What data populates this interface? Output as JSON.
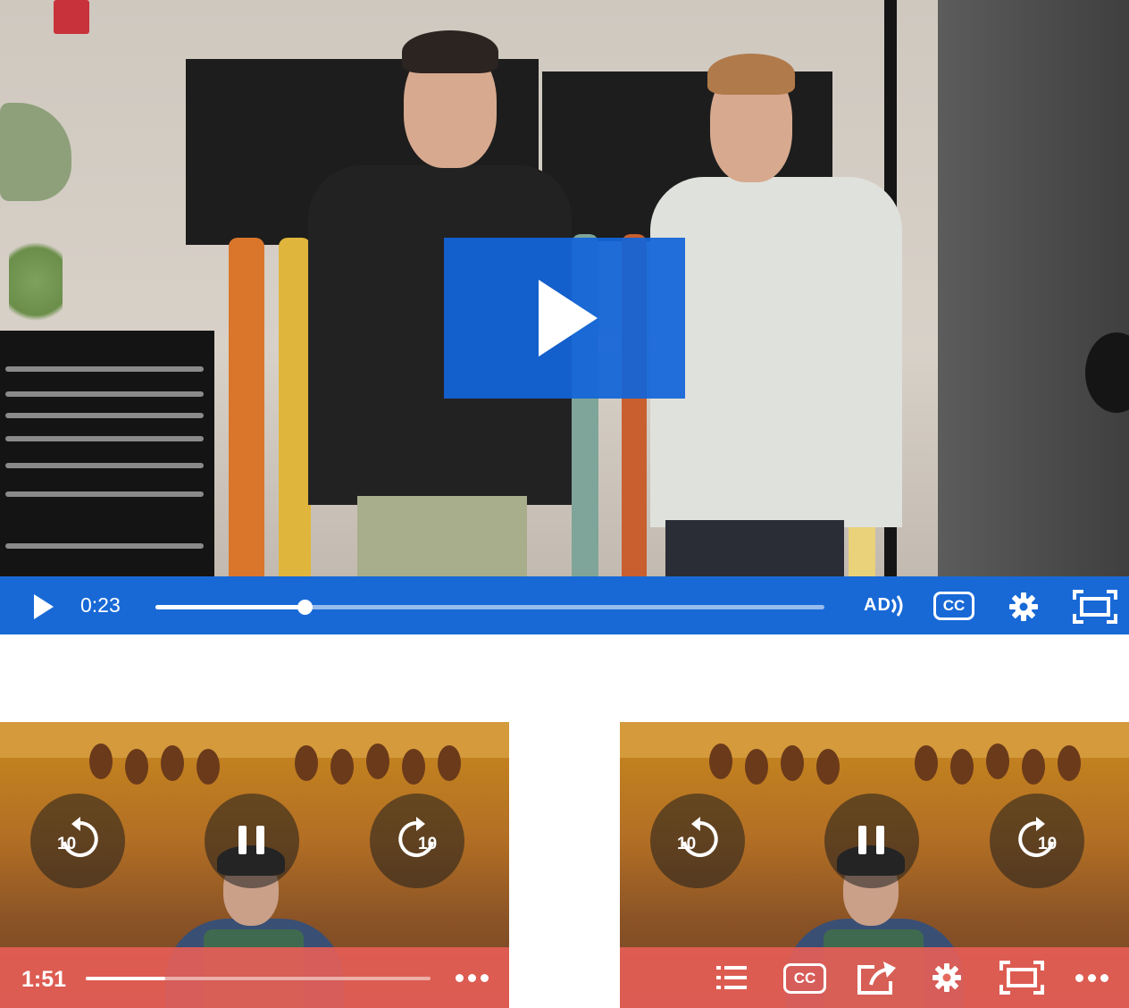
{
  "main_player": {
    "current_time": "0:23",
    "progress_fraction": 0.223,
    "audio_description_label": "AD",
    "captions_label": "CC",
    "accent_color": "#1869d6",
    "controls": [
      "play-icon",
      "audio-description-icon",
      "captions-icon",
      "gear-icon",
      "fullscreen-icon"
    ]
  },
  "player_left": {
    "current_time": "1:51",
    "progress_fraction": 0.23,
    "skip_back_label": "10",
    "skip_forward_label": "10",
    "accent_color": "#e85e56",
    "controls": [
      "rewind-10-icon",
      "pause-icon",
      "forward-10-icon",
      "more-icon"
    ]
  },
  "player_right": {
    "skip_back_label": "10",
    "skip_forward_label": "10",
    "captions_label": "CC",
    "accent_color": "#e85e56",
    "controls": [
      "chapters-list-icon",
      "captions-icon",
      "share-icon",
      "gear-icon",
      "fullscreen-icon",
      "more-icon"
    ]
  }
}
